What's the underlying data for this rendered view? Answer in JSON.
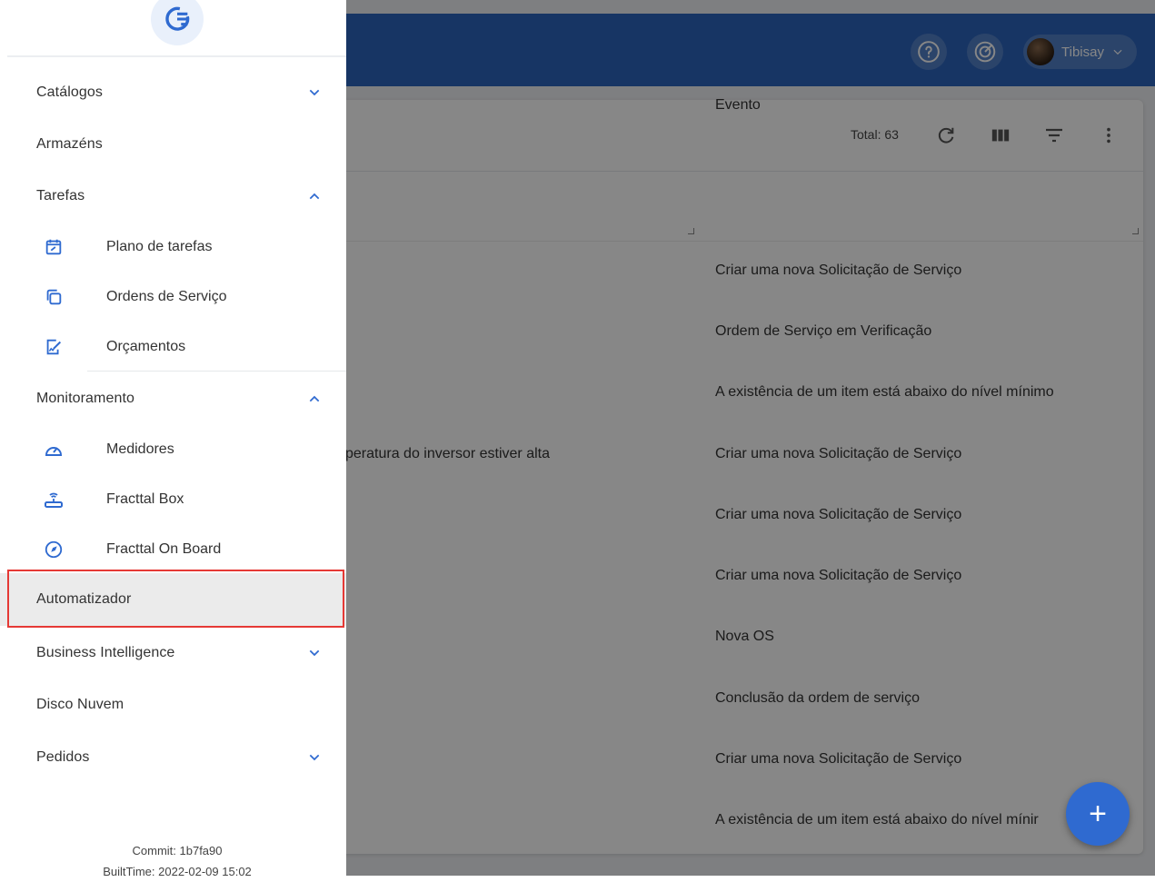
{
  "header": {
    "user_name": "Tibisay",
    "help_icon": "help-circle-icon",
    "target_icon": "target-icon"
  },
  "toolbar": {
    "total": "Total: 63"
  },
  "table": {
    "column_event": "Evento",
    "partial_cell": "peratura do inversor estiver alta",
    "rows": [
      "Criar uma nova Solicitação de Serviço",
      "Ordem de Serviço em Verificação",
      "A existência de um item está abaixo do nível mínimo",
      "Criar uma nova Solicitação de Serviço",
      "Criar uma nova Solicitação de Serviço",
      "Criar uma nova Solicitação de Serviço",
      "Nova OS",
      "Conclusão da ordem de serviço",
      "Criar uma nova Solicitação de Serviço",
      "A existência de um item está abaixo do nível mínir"
    ]
  },
  "fab": {
    "label": "+"
  },
  "drawer": {
    "catalogos": "Catálogos",
    "armazens": "Armazéns",
    "tarefas": "Tarefas",
    "plano_tarefas": "Plano de tarefas",
    "ordens_servico": "Ordens de Serviço",
    "orcamentos": "Orçamentos",
    "monitoramento": "Monitoramento",
    "medidores": "Medidores",
    "fracttal_box": "Fracttal Box",
    "fracttal_on_board": "Fracttal On Board",
    "automatizador": "Automatizador",
    "business_intelligence": "Business Intelligence",
    "disco_nuvem": "Disco Nuvem",
    "pedidos": "Pedidos",
    "commit": "Commit: 1b7fa90",
    "built_time": "BuiltTime: 2022-02-09 15:02"
  },
  "colors": {
    "accent": "#2d64bd",
    "icon_blue": "#2f6ad0",
    "highlight": "#e53935"
  }
}
